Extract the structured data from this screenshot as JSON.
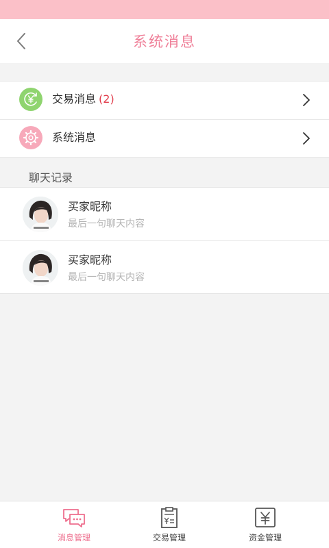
{
  "header": {
    "title": "系统消息"
  },
  "system_items": [
    {
      "label": "交易消息",
      "badge": "(2)",
      "icon": "yen-circle-icon",
      "icon_color": "#8fd46f"
    },
    {
      "label": "系统消息",
      "badge": "",
      "icon": "gear-icon",
      "icon_color": "#f7a9ba"
    }
  ],
  "chat_section": {
    "title": "聊天记录",
    "items": [
      {
        "name": "买家昵称",
        "preview": "最后一句聊天内容"
      },
      {
        "name": "买家昵称",
        "preview": "最后一句聊天内容"
      }
    ]
  },
  "tabbar": {
    "tabs": [
      {
        "label": "消息管理",
        "icon": "chat-bubble-icon",
        "active": true
      },
      {
        "label": "交易管理",
        "icon": "clipboard-yen-icon",
        "active": false
      },
      {
        "label": "资金管理",
        "icon": "yen-box-icon",
        "active": false
      }
    ]
  },
  "colors": {
    "accent": "#ef7f98",
    "status_bar": "#fbc0c8",
    "badge": "#e13b4a"
  }
}
